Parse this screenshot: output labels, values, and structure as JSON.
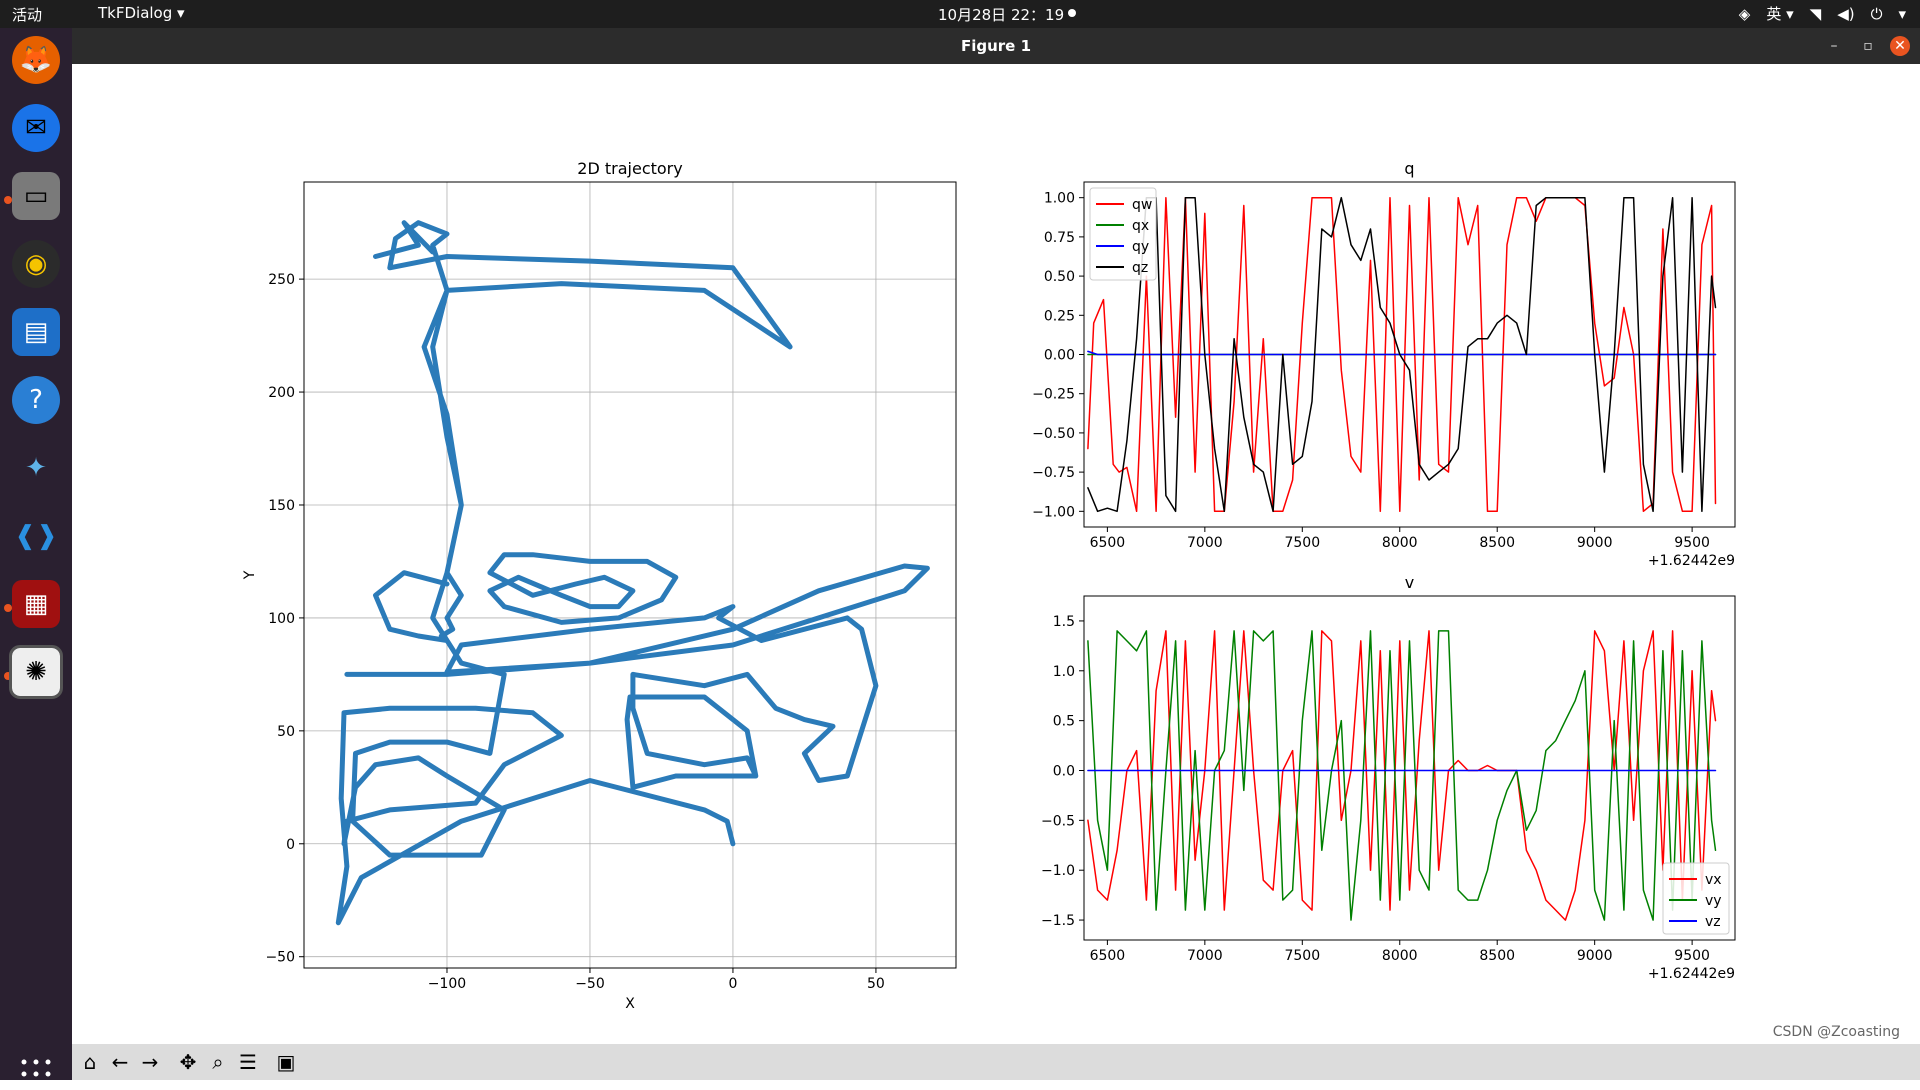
{
  "topbar": {
    "activities": "活动",
    "app_menu": "TkFDialog",
    "clock": "10月28日 22：19",
    "input_method": "英"
  },
  "window": {
    "title": "Figure 1"
  },
  "colors": {
    "traj": "#2b7bb9",
    "qw": "#ff0000",
    "qx": "#008000",
    "qy": "#0000ff",
    "qz": "#000000"
  },
  "watermark": "CSDN @Zcoasting",
  "chart_data": [
    {
      "type": "line",
      "title": "2D trajectory",
      "xlabel": "X",
      "ylabel": "Y",
      "xlim": [
        -150,
        78
      ],
      "ylim": [
        -55,
        293
      ],
      "xticks": [
        -100,
        -50,
        0,
        50
      ],
      "yticks": [
        -50,
        0,
        50,
        100,
        150,
        200,
        250
      ],
      "grid": true,
      "series": [
        {
          "x": [
            0,
            -2,
            -10,
            -50,
            -95,
            -130,
            -138,
            -135,
            -137,
            -136,
            -120,
            -90,
            -70,
            -60,
            -80,
            -90,
            -120,
            -135,
            -136,
            -132,
            -125,
            -110,
            -100,
            -80,
            -88,
            -120,
            -133,
            -132,
            -120,
            -100,
            -85,
            -80,
            -95,
            -105,
            -100,
            -95,
            -100,
            -105,
            -100,
            -105,
            -100,
            -110,
            -118,
            -120,
            -100,
            -50,
            0,
            20,
            -10,
            -60,
            -100,
            -108,
            -100,
            -95,
            -100,
            -95,
            -100,
            -98,
            -102,
            -100,
            -110,
            -120,
            -125,
            -115,
            -100
          ],
          "y": [
            0,
            10,
            15,
            28,
            10,
            -15,
            -35,
            -10,
            20,
            58,
            60,
            60,
            58,
            48,
            35,
            18,
            15,
            10,
            0,
            25,
            35,
            38,
            30,
            15,
            -5,
            -5,
            10,
            40,
            45,
            45,
            40,
            75,
            80,
            100,
            120,
            150,
            180,
            220,
            245,
            265,
            270,
            275,
            268,
            255,
            260,
            258,
            255,
            220,
            245,
            248,
            245,
            220,
            190,
            150,
            120,
            110,
            100,
            95,
            92,
            90,
            92,
            95,
            110,
            120,
            115
          ]
        },
        {
          "x": [
            -135,
            -100,
            -50,
            0,
            30,
            60,
            68,
            60,
            30,
            0,
            -50,
            -100,
            -95,
            -50,
            -10,
            0,
            -5,
            10,
            40,
            45,
            50,
            40,
            30,
            25,
            35,
            25,
            15,
            5,
            -10,
            -35,
            -35,
            -30,
            -10,
            5,
            8,
            -20,
            -35,
            -37,
            -36,
            -10,
            5,
            8
          ],
          "y": [
            75,
            75,
            80,
            95,
            112,
            123,
            122,
            112,
            100,
            88,
            80,
            76,
            88,
            95,
            100,
            105,
            100,
            90,
            100,
            95,
            70,
            30,
            28,
            40,
            52,
            55,
            60,
            75,
            70,
            75,
            60,
            40,
            35,
            38,
            30,
            30,
            25,
            55,
            65,
            65,
            50,
            30
          ]
        },
        {
          "x": [
            -85,
            -80,
            -70,
            -50,
            -30,
            -20,
            -25,
            -40,
            -60,
            -80,
            -85,
            -75,
            -60,
            -50,
            -40,
            -35,
            -45,
            -55,
            -70,
            -85
          ],
          "y": [
            120,
            128,
            128,
            125,
            125,
            118,
            108,
            100,
            98,
            105,
            112,
            118,
            110,
            105,
            105,
            112,
            118,
            115,
            110,
            120
          ]
        },
        {
          "x": [
            -125,
            -110,
            -115,
            -105
          ],
          "y": [
            260,
            265,
            275,
            262
          ]
        }
      ]
    },
    {
      "type": "line",
      "title": "q",
      "xlim": [
        6380,
        9720
      ],
      "ylim": [
        -1.1,
        1.1
      ],
      "xticks": [
        6500,
        7000,
        7500,
        8000,
        8500,
        9000,
        9500
      ],
      "yticks": [
        -1.0,
        -0.75,
        -0.5,
        -0.25,
        0.0,
        0.25,
        0.5,
        0.75,
        1.0
      ],
      "xtick_labels": [
        "6500",
        "7000",
        "7500",
        "8000",
        "8500",
        "9000",
        "9500"
      ],
      "ytick_labels": [
        "−1.00",
        "−0.75",
        "−0.50",
        "−0.25",
        "0.00",
        "0.25",
        "0.50",
        "0.75",
        "1.00"
      ],
      "offset_label": "+1.62442e9",
      "legend_position": "upper-left",
      "series": [
        {
          "name": "qw",
          "x": [
            6400,
            6430,
            6480,
            6530,
            6560,
            6600,
            6650,
            6700,
            6750,
            6800,
            6850,
            6900,
            6950,
            7000,
            7050,
            7100,
            7150,
            7200,
            7250,
            7300,
            7350,
            7400,
            7450,
            7500,
            7550,
            7600,
            7650,
            7700,
            7750,
            7800,
            7850,
            7900,
            7950,
            8000,
            8050,
            8100,
            8150,
            8200,
            8250,
            8300,
            8350,
            8400,
            8450,
            8500,
            8550,
            8600,
            8650,
            8700,
            8750,
            8800,
            8850,
            8900,
            8950,
            9000,
            9050,
            9100,
            9150,
            9200,
            9250,
            9300,
            9350,
            9400,
            9450,
            9500,
            9550,
            9600,
            9620
          ],
          "y": [
            -0.6,
            0.2,
            0.35,
            -0.7,
            -0.75,
            -0.72,
            -1.0,
            0.5,
            -1.0,
            1.0,
            -0.4,
            1.0,
            -0.75,
            0.9,
            -1.0,
            -1.0,
            -0.3,
            0.95,
            -0.75,
            0.1,
            -1.0,
            -1.0,
            -0.8,
            0.2,
            1.0,
            1.0,
            1.0,
            -0.1,
            -0.65,
            -0.75,
            0.6,
            -1.0,
            1.0,
            -1.0,
            0.95,
            -0.8,
            1.0,
            -0.7,
            -0.75,
            1.0,
            0.7,
            0.95,
            -1.0,
            -1.0,
            0.7,
            1.0,
            1.0,
            0.85,
            1.0,
            1.0,
            1.0,
            1.0,
            0.95,
            0.2,
            -0.2,
            -0.15,
            0.3,
            0.0,
            -1.0,
            -0.95,
            0.8,
            -0.75,
            -1.0,
            -1.0,
            0.7,
            0.95,
            -0.95
          ]
        },
        {
          "name": "qx",
          "x": [
            6400,
            9620
          ],
          "y": [
            0.0,
            0.0
          ]
        },
        {
          "name": "qy",
          "x": [
            6400,
            6450,
            9620
          ],
          "y": [
            0.02,
            0.0,
            0.0
          ]
        },
        {
          "name": "qz",
          "x": [
            6400,
            6450,
            6500,
            6550,
            6600,
            6650,
            6700,
            6750,
            6800,
            6850,
            6900,
            6950,
            7000,
            7050,
            7100,
            7150,
            7200,
            7250,
            7300,
            7350,
            7400,
            7450,
            7500,
            7550,
            7600,
            7650,
            7700,
            7750,
            7800,
            7850,
            7900,
            7950,
            8000,
            8050,
            8100,
            8150,
            8200,
            8250,
            8300,
            8350,
            8400,
            8450,
            8500,
            8550,
            8600,
            8650,
            8700,
            8750,
            8800,
            8850,
            8900,
            8950,
            9000,
            9050,
            9100,
            9150,
            9200,
            9250,
            9300,
            9350,
            9400,
            9450,
            9500,
            9550,
            9600,
            9620
          ],
          "y": [
            -0.85,
            -1.0,
            -0.98,
            -1.0,
            -0.55,
            0.1,
            1.0,
            1.0,
            -0.9,
            -1.0,
            1.0,
            1.0,
            0.0,
            -0.6,
            -1.0,
            0.1,
            -0.4,
            -0.7,
            -0.75,
            -1.0,
            0.0,
            -0.7,
            -0.65,
            -0.3,
            0.8,
            0.75,
            1.0,
            0.7,
            0.6,
            0.8,
            0.3,
            0.2,
            0.0,
            -0.1,
            -0.7,
            -0.8,
            -0.75,
            -0.7,
            -0.6,
            0.05,
            0.1,
            0.1,
            0.2,
            0.25,
            0.2,
            0.0,
            0.95,
            1.0,
            1.0,
            1.0,
            1.0,
            1.0,
            0.0,
            -0.75,
            0.0,
            1.0,
            1.0,
            -0.7,
            -1.0,
            0.5,
            1.0,
            -0.75,
            1.0,
            -1.0,
            0.5,
            0.3
          ]
        }
      ]
    },
    {
      "type": "line",
      "title": "v",
      "xlim": [
        6380,
        9720
      ],
      "ylim": [
        -1.7,
        1.75
      ],
      "xticks": [
        6500,
        7000,
        7500,
        8000,
        8500,
        9000,
        9500
      ],
      "yticks": [
        -1.5,
        -1.0,
        -0.5,
        0.0,
        0.5,
        1.0,
        1.5
      ],
      "xtick_labels": [
        "6500",
        "7000",
        "7500",
        "8000",
        "8500",
        "9000",
        "9500"
      ],
      "ytick_labels": [
        "−1.5",
        "−1.0",
        "−0.5",
        "0.0",
        "0.5",
        "1.0",
        "1.5"
      ],
      "offset_label": "+1.62442e9",
      "legend_position": "lower-right",
      "series": [
        {
          "name": "vx",
          "x": [
            6400,
            6450,
            6500,
            6550,
            6600,
            6650,
            6700,
            6750,
            6800,
            6850,
            6900,
            6950,
            7000,
            7050,
            7100,
            7150,
            7200,
            7250,
            7300,
            7350,
            7400,
            7450,
            7500,
            7550,
            7600,
            7650,
            7700,
            7750,
            7800,
            7850,
            7900,
            7950,
            8000,
            8050,
            8100,
            8150,
            8200,
            8250,
            8300,
            8350,
            8400,
            8450,
            8500,
            8550,
            8600,
            8650,
            8700,
            8750,
            8800,
            8850,
            8900,
            8950,
            9000,
            9050,
            9100,
            9150,
            9200,
            9250,
            9300,
            9350,
            9400,
            9450,
            9500,
            9550,
            9600,
            9620
          ],
          "y": [
            -0.5,
            -1.2,
            -1.3,
            -0.8,
            0.0,
            0.2,
            -1.3,
            0.8,
            1.4,
            -1.2,
            1.3,
            -0.9,
            0.0,
            1.4,
            -1.4,
            0.0,
            1.4,
            0.0,
            -1.1,
            -1.2,
            0.0,
            0.2,
            -1.3,
            -1.4,
            1.4,
            1.3,
            -0.5,
            0.0,
            1.3,
            -1.0,
            1.2,
            -1.4,
            1.3,
            -1.2,
            0.3,
            1.4,
            -1.0,
            0.0,
            0.1,
            0.0,
            0.0,
            0.05,
            0.0,
            0.0,
            0.0,
            -0.8,
            -1.0,
            -1.3,
            -1.4,
            -1.5,
            -1.2,
            -0.5,
            1.4,
            1.2,
            0.0,
            1.3,
            -0.5,
            1.0,
            1.4,
            -1.0,
            1.4,
            -1.3,
            1.0,
            -1.2,
            0.8,
            0.5
          ]
        },
        {
          "name": "vy",
          "x": [
            6400,
            6450,
            6500,
            6550,
            6600,
            6650,
            6700,
            6750,
            6800,
            6850,
            6900,
            6950,
            7000,
            7050,
            7100,
            7150,
            7200,
            7250,
            7300,
            7350,
            7400,
            7450,
            7500,
            7550,
            7600,
            7650,
            7700,
            7750,
            7800,
            7850,
            7900,
            7950,
            8000,
            8050,
            8100,
            8150,
            8200,
            8250,
            8300,
            8350,
            8400,
            8450,
            8500,
            8550,
            8600,
            8650,
            8700,
            8750,
            8800,
            8850,
            8900,
            8950,
            9000,
            9050,
            9100,
            9150,
            9200,
            9250,
            9300,
            9350,
            9400,
            9450,
            9500,
            9550,
            9600,
            9620
          ],
          "y": [
            1.3,
            -0.5,
            -1.0,
            1.4,
            1.3,
            1.2,
            1.4,
            -1.4,
            0.0,
            1.3,
            -1.4,
            0.2,
            -1.4,
            0.0,
            0.2,
            1.4,
            -0.2,
            1.4,
            1.3,
            1.4,
            -1.3,
            -1.2,
            0.5,
            1.4,
            -0.8,
            0.0,
            0.5,
            -1.5,
            -0.5,
            1.4,
            -1.3,
            1.2,
            -1.3,
            1.3,
            -1.0,
            -1.2,
            1.4,
            1.4,
            -1.2,
            -1.3,
            -1.3,
            -1.0,
            -0.5,
            -0.2,
            0.0,
            -0.6,
            -0.4,
            0.2,
            0.3,
            0.5,
            0.7,
            1.0,
            -1.2,
            -1.5,
            0.5,
            -1.4,
            1.3,
            -1.2,
            -1.5,
            1.2,
            -1.4,
            1.2,
            -1.3,
            1.3,
            -0.5,
            -0.8
          ]
        },
        {
          "name": "vz",
          "x": [
            6400,
            9620
          ],
          "y": [
            0.0,
            0.0
          ]
        }
      ]
    }
  ]
}
